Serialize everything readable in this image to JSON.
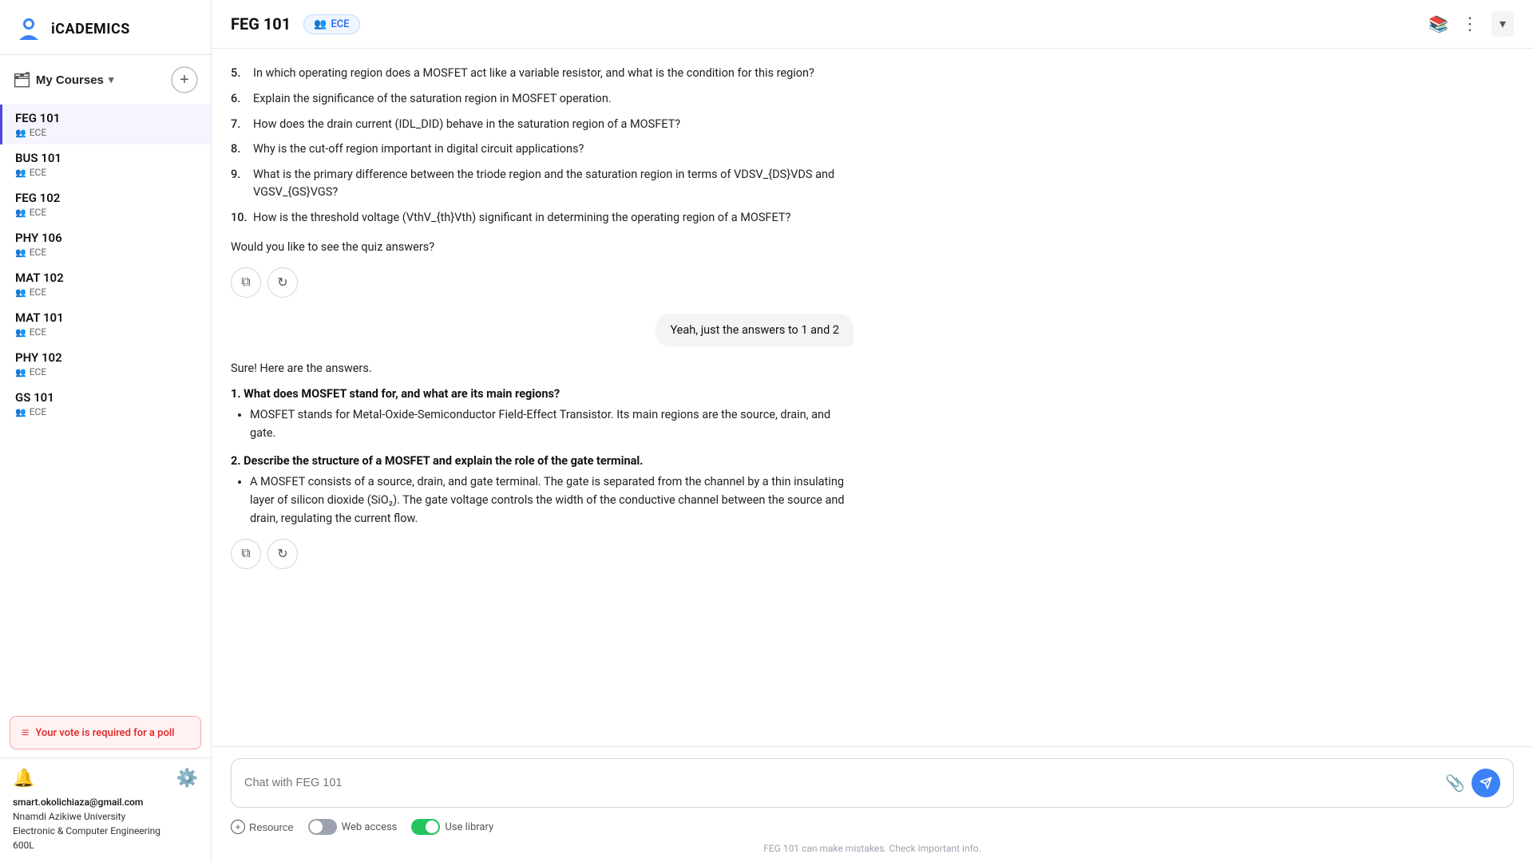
{
  "app": {
    "name": "iCADEMICS"
  },
  "sidebar": {
    "my_courses_label": "My Courses",
    "add_button_label": "+",
    "courses": [
      {
        "code": "FEG 101",
        "dept": "ECE",
        "active": true
      },
      {
        "code": "BUS 101",
        "dept": "ECE",
        "active": false
      },
      {
        "code": "FEG 102",
        "dept": "ECE",
        "active": false
      },
      {
        "code": "PHY 106",
        "dept": "ECE",
        "active": false
      },
      {
        "code": "MAT 102",
        "dept": "ECE",
        "active": false
      },
      {
        "code": "MAT 101",
        "dept": "ECE",
        "active": false
      },
      {
        "code": "PHY 102",
        "dept": "ECE",
        "active": false
      },
      {
        "code": "GS 101",
        "dept": "ECE",
        "active": false
      }
    ],
    "poll_banner": "Your vote is required for a poll",
    "user": {
      "email": "smart.okolichiaza@gmail.com",
      "university": "Nnamdi Azikiwe University",
      "department": "Electronic & Computer Engineering",
      "level": "600L"
    }
  },
  "topbar": {
    "course_title": "FEG 101",
    "ece_badge": "ECE"
  },
  "chat": {
    "questions": [
      {
        "num": "5.",
        "text": "In which operating region does a MOSFET act like a variable resistor, and what is the condition for this region?"
      },
      {
        "num": "6.",
        "text": "Explain the significance of the saturation region in MOSFET operation."
      },
      {
        "num": "7.",
        "text": "How does the drain current (IDL_DID) behave in the saturation region of a MOSFET?"
      },
      {
        "num": "8.",
        "text": "Why is the cut-off region important in digital circuit applications?"
      },
      {
        "num": "9.",
        "text": "What is the primary difference between the triode region and the saturation region in terms of VDSV_{DS}VDS and VGSV_{GS}VGS?"
      },
      {
        "num": "10.",
        "text": "How is the threshold voltage (VthV_{th}Vth) significant in determining the operating region of a MOSFET?"
      }
    ],
    "quiz_prompt": "Would you like to see the quiz answers?",
    "user_message": "Yeah, just the answers to 1 and 2",
    "ai_response_intro": "Sure! Here are the answers.",
    "answers": [
      {
        "num": "1.",
        "title": "What does MOSFET stand for, and what are its main regions?",
        "bullets": [
          "MOSFET stands for Metal-Oxide-Semiconductor Field-Effect Transistor. Its main regions are the source, drain, and gate."
        ]
      },
      {
        "num": "2.",
        "title": "Describe the structure of a MOSFET and explain the role of the gate terminal.",
        "bullets": [
          "A MOSFET consists of a source, drain, and gate terminal. The gate is separated from the channel by a thin insulating layer of silicon dioxide (SiO₂). The gate voltage controls the width of the conductive channel between the source and drain, regulating the current flow."
        ]
      }
    ]
  },
  "input": {
    "placeholder": "Chat with FEG 101",
    "resource_label": "Resource",
    "web_access_label": "Web access",
    "use_library_label": "Use library",
    "disclaimer": "FEG 101 can make mistakes. Check important info."
  }
}
